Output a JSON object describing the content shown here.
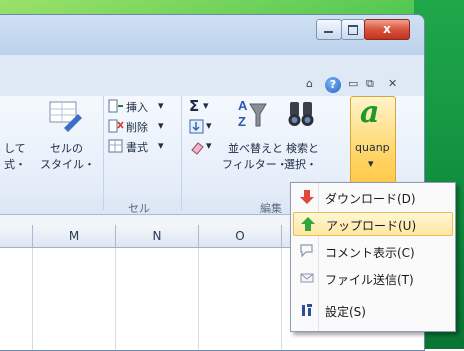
{
  "window": {
    "close_label": "x"
  },
  "ribbon": {
    "cells_partial_left": "して",
    "cells_partial_left2": "式・",
    "cell_style_line1": "セルの",
    "cell_style_line2": "スタイル・",
    "cells_group": {
      "insert": "挿入",
      "delete": "削除",
      "format": "書式",
      "label": "セル"
    },
    "editing_group": {
      "sum_symbol": "Σ",
      "sort_filter_line1": "並べ替えと",
      "sort_filter_line2": "フィルター・",
      "find_select_line1": "検索と",
      "find_select_line2": "選択・",
      "label": "編集"
    },
    "quanp": {
      "label": "quanp",
      "logo_letter": "a"
    }
  },
  "columns": [
    "M",
    "N",
    "O"
  ],
  "menu": {
    "items": [
      {
        "label": "ダウンロード(D)",
        "icon": "download-arrow-icon",
        "color": "#e0493a"
      },
      {
        "label": "アップロード(U)",
        "icon": "upload-arrow-icon",
        "color": "#2fa83a"
      },
      {
        "label": "コメント表示(C)",
        "icon": "comment-icon",
        "color": "#8a96a8"
      },
      {
        "label": "ファイル送信(T)",
        "icon": "mail-icon",
        "color": "#8a96a8"
      },
      {
        "label": "設定(S)",
        "icon": "settings-icon",
        "color": "#2c4f9a"
      }
    ]
  }
}
